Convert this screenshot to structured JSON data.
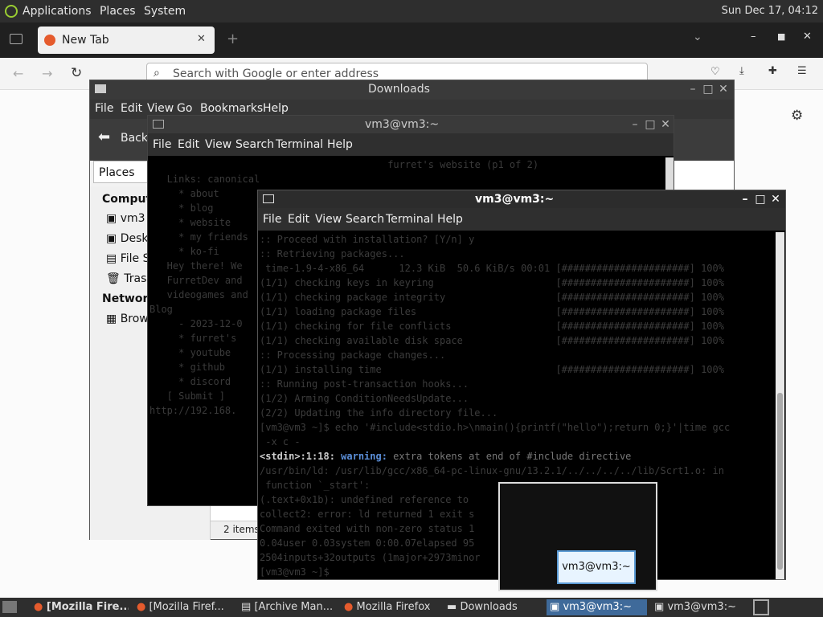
{
  "top_panel": {
    "menus": [
      "Applications",
      "Places",
      "System"
    ],
    "clock": "Sun Dec 17, 04:12"
  },
  "firefox": {
    "tab_title": "New Tab",
    "url_placeholder": "Search with Google or enter address"
  },
  "downloads": {
    "title": "Downloads",
    "menu": [
      "File",
      "Edit",
      "View",
      "Go",
      "Bookmarks",
      "Help"
    ],
    "back_label": "Back",
    "places_label": "Places",
    "sidebar": {
      "computer_heading": "Compute",
      "computer_items": [
        "vm3",
        "Deskt",
        "File S",
        "Trash"
      ],
      "network_heading": "Network",
      "network_items": [
        "Brow"
      ]
    },
    "status": "2 items,"
  },
  "terminal_back": {
    "title": "vm3@vm3:~",
    "menu": [
      "File",
      "Edit",
      "View",
      "Search",
      "Terminal",
      "Help"
    ],
    "lines": [
      "                                         furret's website (p1 of 2)",
      "   Links: canonical",
      "     * about",
      "     * blog",
      "     * website",
      "     * my friends",
      "     * ko-fi",
      "",
      "",
      "   Hey there! We",
      "   FurretDev and",
      "   videogames and",
      "",
      "Blog",
      "",
      "     - 2023-12-0",
      "",
      "     * furret's",
      "     * youtube",
      "     * github",
      "     * discord",
      "   [ Submit ]",
      "http://192.168."
    ]
  },
  "terminal_front": {
    "title": "vm3@vm3:~",
    "menu": [
      "File",
      "Edit",
      "View",
      "Search",
      "Terminal",
      "Help"
    ],
    "lines": [
      ":: Proceed with installation? [Y/n] y",
      ":: Retrieving packages...",
      " time-1.9-4-x86_64      12.3 KiB  50.6 KiB/s 00:01 [######################] 100%",
      "(1/1) checking keys in keyring                     [######################] 100%",
      "(1/1) checking package integrity                   [######################] 100%",
      "(1/1) loading package files                        [######################] 100%",
      "(1/1) checking for file conflicts                  [######################] 100%",
      "(1/1) checking available disk space                [######################] 100%",
      ":: Processing package changes...",
      "(1/1) installing time                              [######################] 100%",
      ":: Running post-transaction hooks...",
      "(1/2) Arming ConditionNeedsUpdate...",
      "(2/2) Updating the info directory file...",
      "[vm3@vm3 ~]$ echo '#include<stdio.h>\\nmain(){printf(\"hello\");return 0;}'|time gcc",
      " -x c -",
      "<stdin>:1:18: warning: extra tokens at end of #include directive",
      "/usr/bin/ld: /usr/lib/gcc/x86_64-pc-linux-gnu/13.2.1/../../../../lib/Scrt1.o: in",
      " function `_start':",
      "(.text+0x1b): undefined reference to",
      "collect2: error: ld returned 1 exit s",
      "Command exited with non-zero status 1",
      "0.04user 0.03system 0:00.07elapsed 95",
      "2504inputs+32outputs (1major+2973minor",
      "[vm3@vm3 ~]$ "
    ],
    "warning_prefix": "<stdin>:1:18:",
    "warning_word": "warning:"
  },
  "taskbar": {
    "items": [
      "[Mozilla Fire...",
      "[Mozilla Firef...",
      "[Archive Man...",
      "Mozilla Firefox",
      "Downloads",
      "vm3@vm3:~",
      "vm3@vm3:~"
    ],
    "tooltip": "vm3@vm3:~"
  },
  "colors": {
    "panel": "#2e2e2e",
    "terminal_bg": "#000000",
    "accent": "#3f6a9a",
    "warning": "#5b8fd9"
  }
}
